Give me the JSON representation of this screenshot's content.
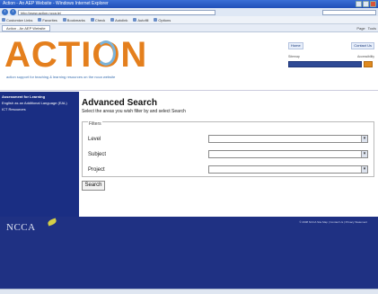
{
  "browser": {
    "title": "Action - An AEP Website - Windows Internet Explorer",
    "url": "http://www.action.ncca.ie/",
    "tab_label": "Action - An AEP Website"
  },
  "toolbar": {
    "items": [
      "Customize Links",
      "Favorites",
      "Bookmarks",
      "Check",
      "Autolink",
      "Autofill",
      "Options"
    ]
  },
  "tab_tools": [
    "Page",
    "Tools"
  ],
  "header": {
    "logo_text": "ACTION",
    "tagline": "action support for teaching & learning resources on the ncca website",
    "links": [
      "Home",
      "Contact Us"
    ],
    "sub_links": [
      "Sitemap",
      "Accessibility"
    ]
  },
  "sidebar": {
    "items": [
      {
        "label": "Assessment for Learning",
        "sub": false
      },
      {
        "label": "English as an Additional Language (EAL)",
        "sub": true
      },
      {
        "label": "ICT Resources",
        "sub": true
      }
    ]
  },
  "main": {
    "title": "Advanced Search",
    "description": "Select the areas you wish filter by and select Search",
    "filters_legend": "Filters",
    "filters": [
      {
        "label": "Level"
      },
      {
        "label": "Subject"
      },
      {
        "label": "Project"
      }
    ],
    "search_label": "Search"
  },
  "footer": {
    "logo": "NCCA",
    "text": "© 2008 NCCA Site Map | Contact Us | Privacy Statement"
  },
  "colors": {
    "brand_orange": "#e47f1d",
    "brand_blue": "#1a2e83"
  }
}
